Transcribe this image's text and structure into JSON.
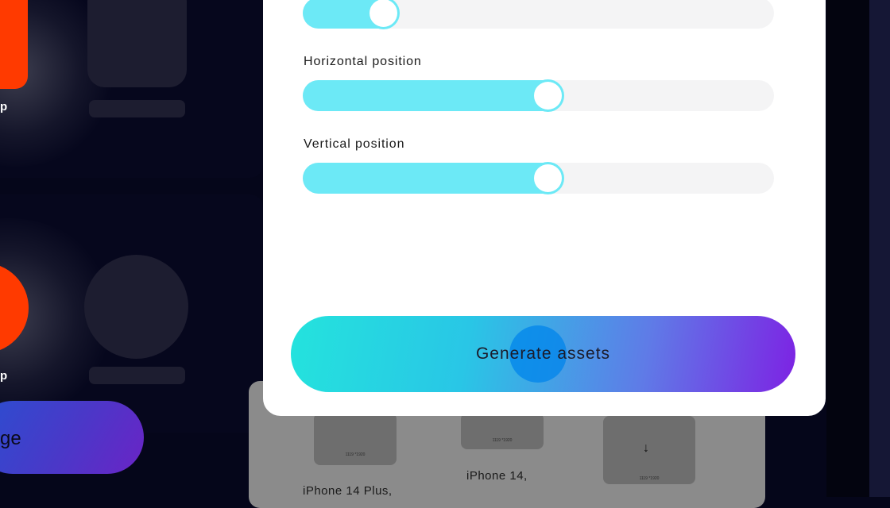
{
  "left_cards": {
    "top_card": {
      "app_label": "p"
    },
    "bottom_card": {
      "app_label": "p"
    },
    "bottom_button_label": "ge"
  },
  "device_panel": {
    "thumbs": [
      {
        "tiny_text": "1119 *1920",
        "label": "iPhone 14 Plus,"
      },
      {
        "tiny_text": "1119 *1920",
        "label": "iPhone 14,"
      },
      {
        "tiny_text": "1119 *1920",
        "label": ""
      }
    ]
  },
  "sliders": {
    "top": {
      "label": "",
      "value_percent": 17
    },
    "horizontal": {
      "label": "Horizontal position",
      "value_percent": 52
    },
    "vertical": {
      "label": "Vertical position",
      "value_percent": 52
    }
  },
  "generate_button": {
    "label": "Generate assets"
  },
  "colors": {
    "slider_fill": "#6ce9f6",
    "slider_track": "#f4f4f5",
    "button_gradient_start": "#24e3dd",
    "button_gradient_end": "#7d22e3",
    "app_icon": "#ff3a00",
    "touch_indicator": "#0084eb"
  },
  "icons": [
    "arrow-down-icon"
  ]
}
